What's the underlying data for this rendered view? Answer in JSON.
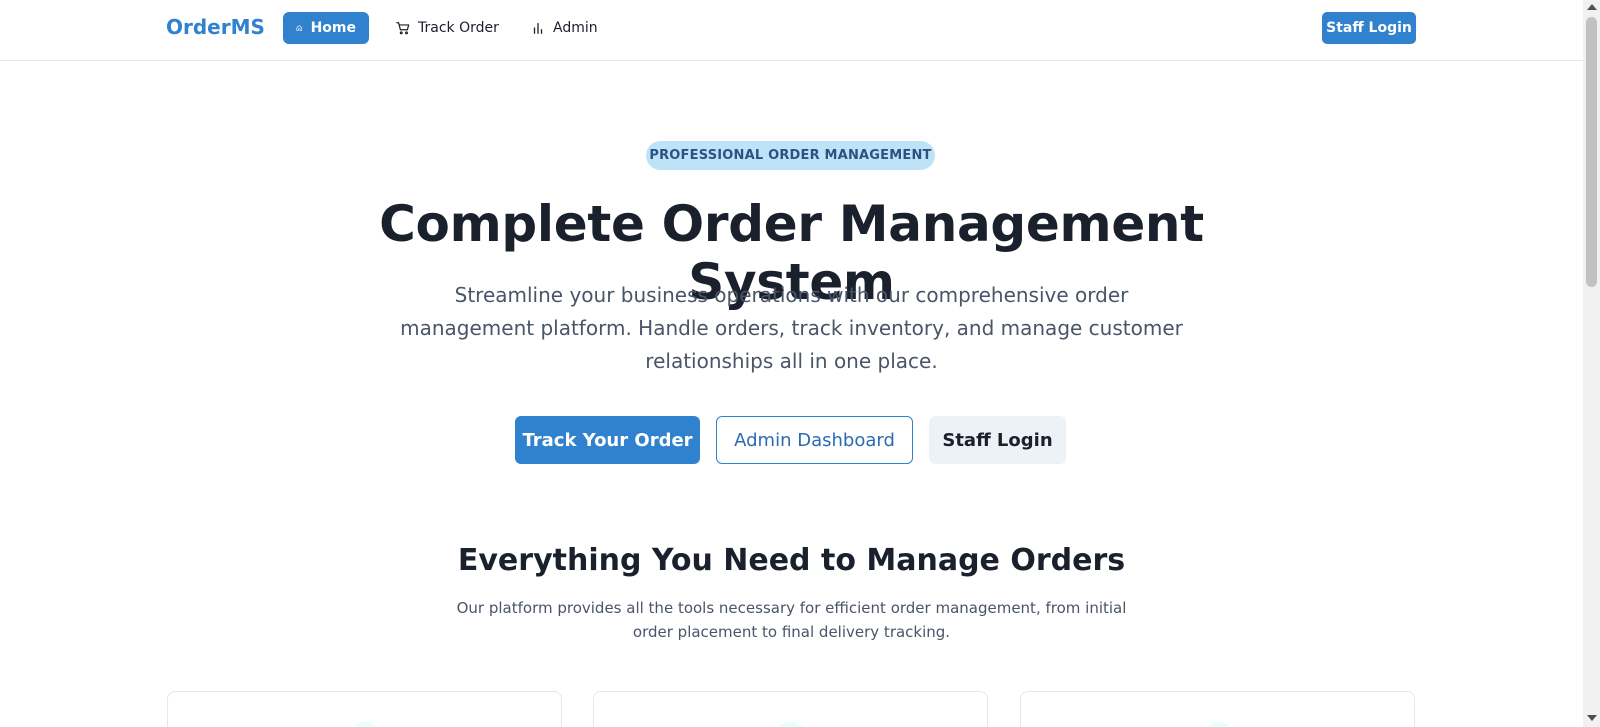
{
  "nav": {
    "brand": "OrderMS",
    "links": [
      {
        "label": "Home",
        "icon": "home-icon",
        "active": true
      },
      {
        "label": "Track Order",
        "icon": "cart-icon",
        "active": false
      },
      {
        "label": "Admin",
        "icon": "bar-chart-icon",
        "active": false
      }
    ],
    "staff_login": "Staff Login"
  },
  "hero": {
    "badge": "PROFESSIONAL ORDER MANAGEMENT",
    "title": "Complete Order Management System",
    "subtitle": "Streamline your business operations with our comprehensive order management platform. Handle orders, track inventory, and manage customer relationships all in one place.",
    "buttons": {
      "track": "Track Your Order",
      "admin": "Admin Dashboard",
      "staff": "Staff Login"
    }
  },
  "features": {
    "title": "Everything You Need to Manage Orders",
    "subtitle": "Our platform provides all the tools necessary for efficient order management, from initial order placement to final delivery tracking."
  },
  "colors": {
    "primary": "#3182ce",
    "badge_bg": "#bee3f8",
    "badge_text": "#2c5282",
    "text_dark": "#1a202c",
    "text_muted": "#4a5568"
  }
}
